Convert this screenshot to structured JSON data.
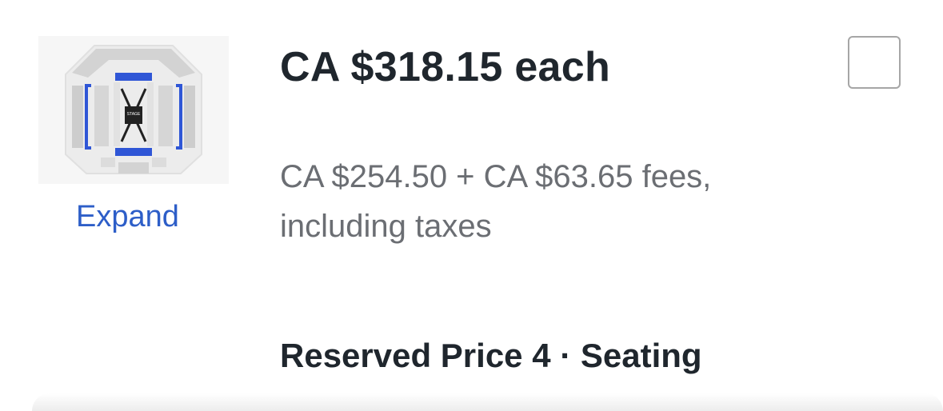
{
  "listing": {
    "price_total": "CA $318.15 each",
    "price_breakdown_line1": "CA $254.50 + CA $63.65 fees,",
    "price_breakdown_line2": "including taxes",
    "ticket_type": "Reserved Price 4 · Seating",
    "expand_label": "Expand",
    "stage_label": "STAGE",
    "selected": false
  },
  "colors": {
    "link": "#2d5ec8",
    "highlight_section": "#2f56d6",
    "section_grey": "#c9c9c9",
    "text_primary": "#1f262d",
    "text_secondary": "#6b6e73"
  },
  "icons": {
    "seat_map": "venue-seat-map-icon",
    "checkbox": "checkbox-empty"
  }
}
